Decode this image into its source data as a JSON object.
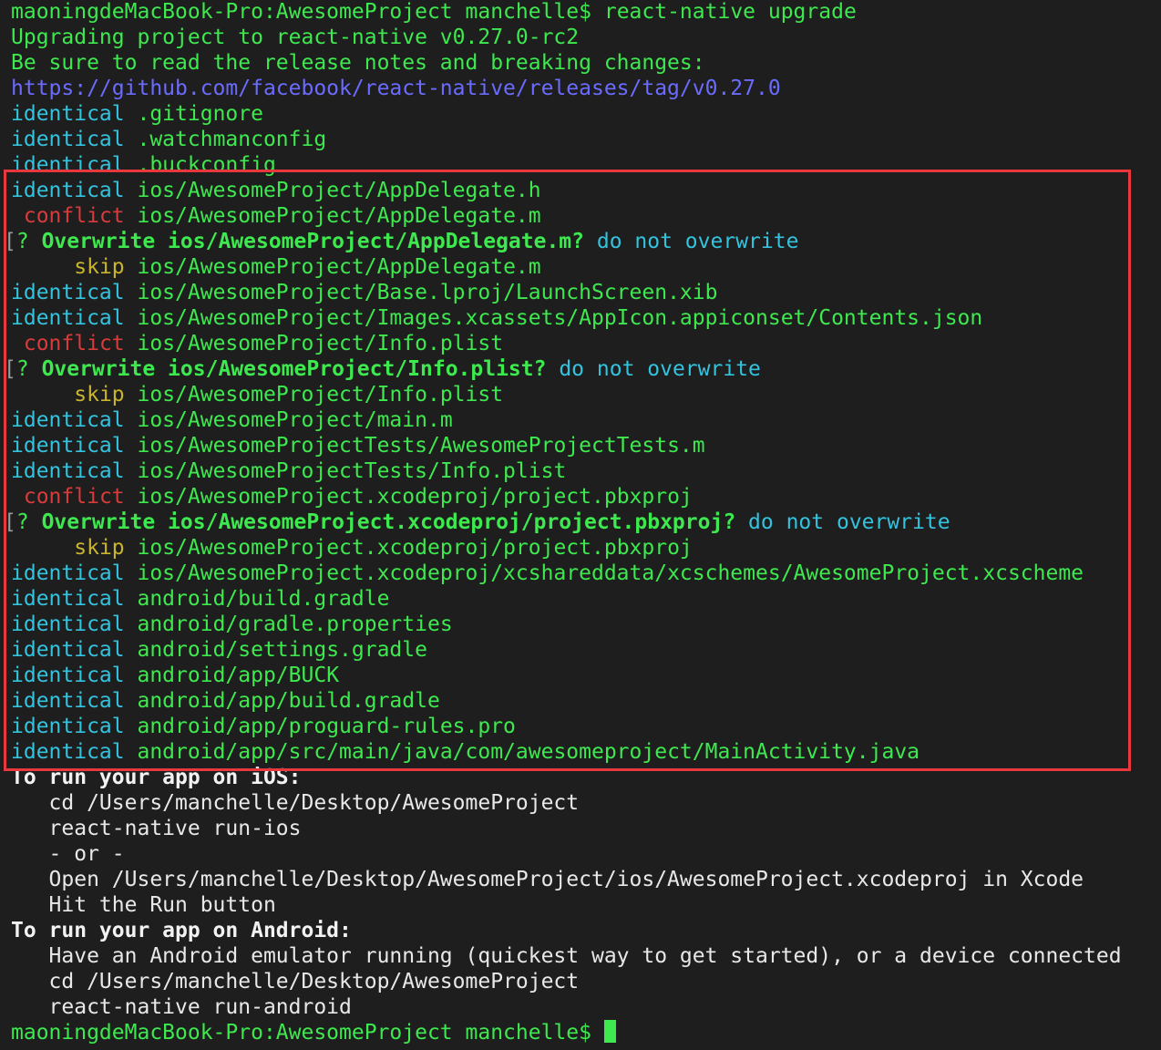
{
  "terminal": {
    "prompt_cmd": {
      "prompt": "maoningdeMacBook-Pro:AwesomeProject manchelle$",
      "command": "react-native upgrade"
    },
    "info": [
      "Upgrading project to react-native v0.27.0-rc2",
      "Be sure to read the release notes and breaking changes:"
    ],
    "release_url": "https://github.com/facebook/react-native/releases/tag/v0.27.0",
    "files_top": [
      {
        "status": "identical",
        "path": ".gitignore"
      },
      {
        "status": "identical",
        "path": ".watchmanconfig"
      },
      {
        "status": "identical",
        "path": ".buckconfig"
      }
    ],
    "files_boxed": [
      {
        "kind": "file",
        "status": "identical",
        "path": "ios/AwesomeProject/AppDelegate.h"
      },
      {
        "kind": "file",
        "status": "conflict",
        "path": "ios/AwesomeProject/AppDelegate.m"
      },
      {
        "kind": "question",
        "mark": "?",
        "text": "Overwrite ios/AwesomeProject/AppDelegate.m?",
        "answer": "do not overwrite"
      },
      {
        "kind": "file",
        "status": "skip",
        "path": "ios/AwesomeProject/AppDelegate.m"
      },
      {
        "kind": "file",
        "status": "identical",
        "path": "ios/AwesomeProject/Base.lproj/LaunchScreen.xib"
      },
      {
        "kind": "file",
        "status": "identical",
        "path": "ios/AwesomeProject/Images.xcassets/AppIcon.appiconset/Contents.json"
      },
      {
        "kind": "file",
        "status": "conflict",
        "path": "ios/AwesomeProject/Info.plist"
      },
      {
        "kind": "question",
        "mark": "?",
        "text": "Overwrite ios/AwesomeProject/Info.plist?",
        "answer": "do not overwrite"
      },
      {
        "kind": "file",
        "status": "skip",
        "path": "ios/AwesomeProject/Info.plist"
      },
      {
        "kind": "file",
        "status": "identical",
        "path": "ios/AwesomeProject/main.m"
      },
      {
        "kind": "file",
        "status": "identical",
        "path": "ios/AwesomeProjectTests/AwesomeProjectTests.m"
      },
      {
        "kind": "file",
        "status": "identical",
        "path": "ios/AwesomeProjectTests/Info.plist"
      },
      {
        "kind": "file",
        "status": "conflict",
        "path": "ios/AwesomeProject.xcodeproj/project.pbxproj"
      },
      {
        "kind": "question",
        "mark": "?",
        "text": "Overwrite ios/AwesomeProject.xcodeproj/project.pbxproj?",
        "answer": "do not overwrite"
      },
      {
        "kind": "file",
        "status": "skip",
        "path": "ios/AwesomeProject.xcodeproj/project.pbxproj"
      },
      {
        "kind": "file",
        "status": "identical",
        "path": "ios/AwesomeProject.xcodeproj/xcshareddata/xcschemes/AwesomeProject.xcscheme"
      },
      {
        "kind": "file",
        "status": "identical",
        "path": "android/build.gradle"
      },
      {
        "kind": "file",
        "status": "identical",
        "path": "android/gradle.properties"
      },
      {
        "kind": "file",
        "status": "identical",
        "path": "android/settings.gradle"
      },
      {
        "kind": "file",
        "status": "identical",
        "path": "android/app/BUCK"
      },
      {
        "kind": "file",
        "status": "identical",
        "path": "android/app/build.gradle"
      },
      {
        "kind": "file",
        "status": "identical",
        "path": "android/app/proguard-rules.pro"
      },
      {
        "kind": "file",
        "status": "identical",
        "path": "android/app/src/main/java/com/awesomeproject/MainActivity.java"
      }
    ],
    "ios_heading": "To run your app on iOS:",
    "ios_steps": [
      "cd /Users/manchelle/Desktop/AwesomeProject",
      "react-native run-ios",
      "- or -",
      "Open /Users/manchelle/Desktop/AwesomeProject/ios/AwesomeProject.xcodeproj in Xcode",
      "Hit the Run button"
    ],
    "android_heading": "To run your app on Android:",
    "android_steps": [
      "Have an Android emulator running (quickest way to get started), or a device connected",
      "cd /Users/manchelle/Desktop/AwesomeProject",
      "react-native run-android"
    ],
    "final_prompt": "maoningdeMacBook-Pro:AwesomeProject manchelle$"
  },
  "colors": {
    "background": "#1e1e1e",
    "prompt": "#3ee84f",
    "identical": "#33c3de",
    "conflict": "#d83b3b",
    "skip": "#c9b52c",
    "link": "#6b6bff",
    "highlight_border": "#e8383d"
  }
}
